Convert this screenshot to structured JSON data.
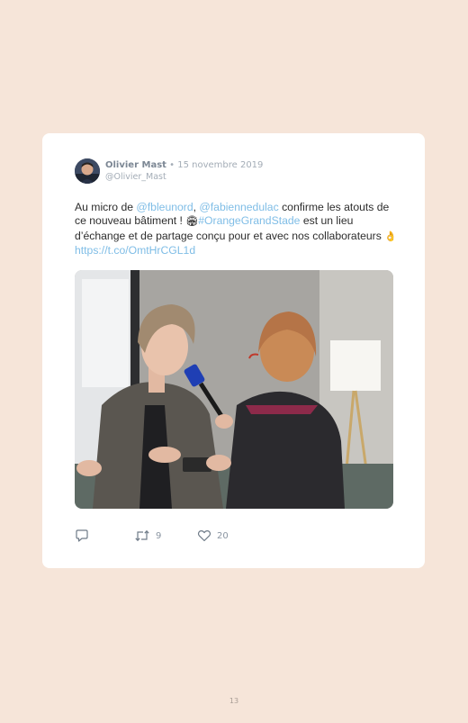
{
  "tweet": {
    "author_name": "Olivier Mast",
    "separator": "•",
    "date": "15 novembre 2019",
    "handle": "@Olivier_Mast",
    "text": {
      "part1": "Au micro de ",
      "mention1": "@fbleunord",
      "comma": ", ",
      "mention2": "@fabiennedulac",
      "part2": " confirme les atouts de ce nouveau bâtiment ! ",
      "emoji1": "🏟",
      "hashtag": "#OrangeGrandStade",
      "part3": " est un lieu d’échange et de partage conçu pour et avec nos collaborateurs ",
      "emoji2": "👌",
      "space": " ",
      "url": "https://t.co/OmtHrCGL1d"
    },
    "actions": {
      "retweets": "9",
      "likes": "20"
    },
    "icons": {
      "reply": "reply-icon",
      "retweet": "retweet-icon",
      "like": "heart-icon"
    }
  },
  "page": {
    "number": "13"
  },
  "colors": {
    "background": "#f6e5d9",
    "card": "#ffffff",
    "link": "#7fbde6",
    "muted": "#a3acb6"
  }
}
